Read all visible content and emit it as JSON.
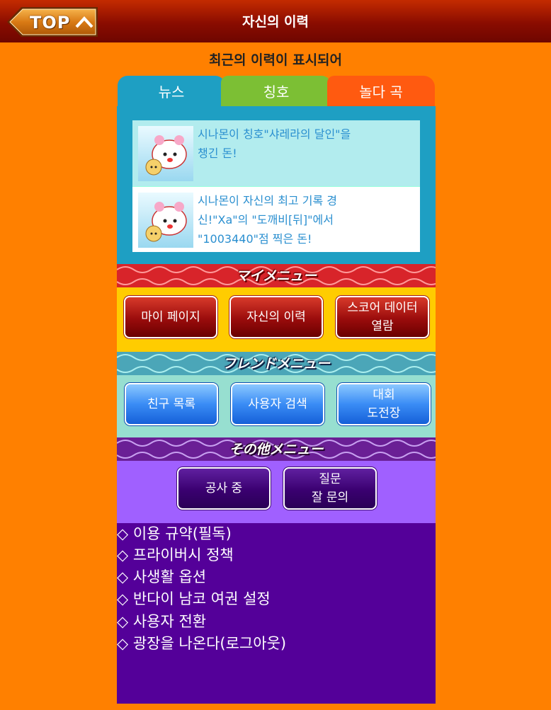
{
  "header": {
    "top_label": "TOP",
    "title": "자신의 이력"
  },
  "subtitle": "최근의 이력이 표시되어",
  "tabs": [
    {
      "label": "뉴스",
      "color": "#1e9fc3"
    },
    {
      "label": "칭호",
      "color": "#7cbf34"
    },
    {
      "label": "놀다 곡",
      "color": "#ff5a10"
    }
  ],
  "news": [
    {
      "text": "시나몬이 칭호\"샤레라의 달인\"을 챙긴 돈!"
    },
    {
      "text": "시나몬이 자신의 최고 기록 경신!\"Xa\"의 \"도깨비[뒤]\"에서 \"1003440\"점 찍은 돈!"
    }
  ],
  "banners": {
    "my_menu": "マイメニュー",
    "friend_menu": "フレンドメニュー",
    "other_menu": "その他メニュー"
  },
  "my_menu": [
    "마이 페이지",
    "자신의 이력",
    "스코어 데이터\n열람"
  ],
  "friend_menu": [
    "친구 목록",
    "사용자 검색",
    "대회\n도전장"
  ],
  "other_menu": [
    "공사 중",
    "질문\n잘 문의"
  ],
  "links": [
    "◇ 이용 규약(필독)",
    "◇ 프라이버시 정책",
    "◇ 사생활 옵션",
    "◇ 반다이 남코 여권 설정",
    "◇ 사용자 전환",
    "◇ 광장을 나온다(로그아웃)"
  ],
  "colors": {
    "page_bg": "#ff8000",
    "header_bg": "#8a0c00",
    "my_menu_bg": "#ffcc00",
    "friend_menu_bg": "#97dfd0",
    "other_menu_bg": "#a060ff",
    "links_bg": "#540099"
  }
}
